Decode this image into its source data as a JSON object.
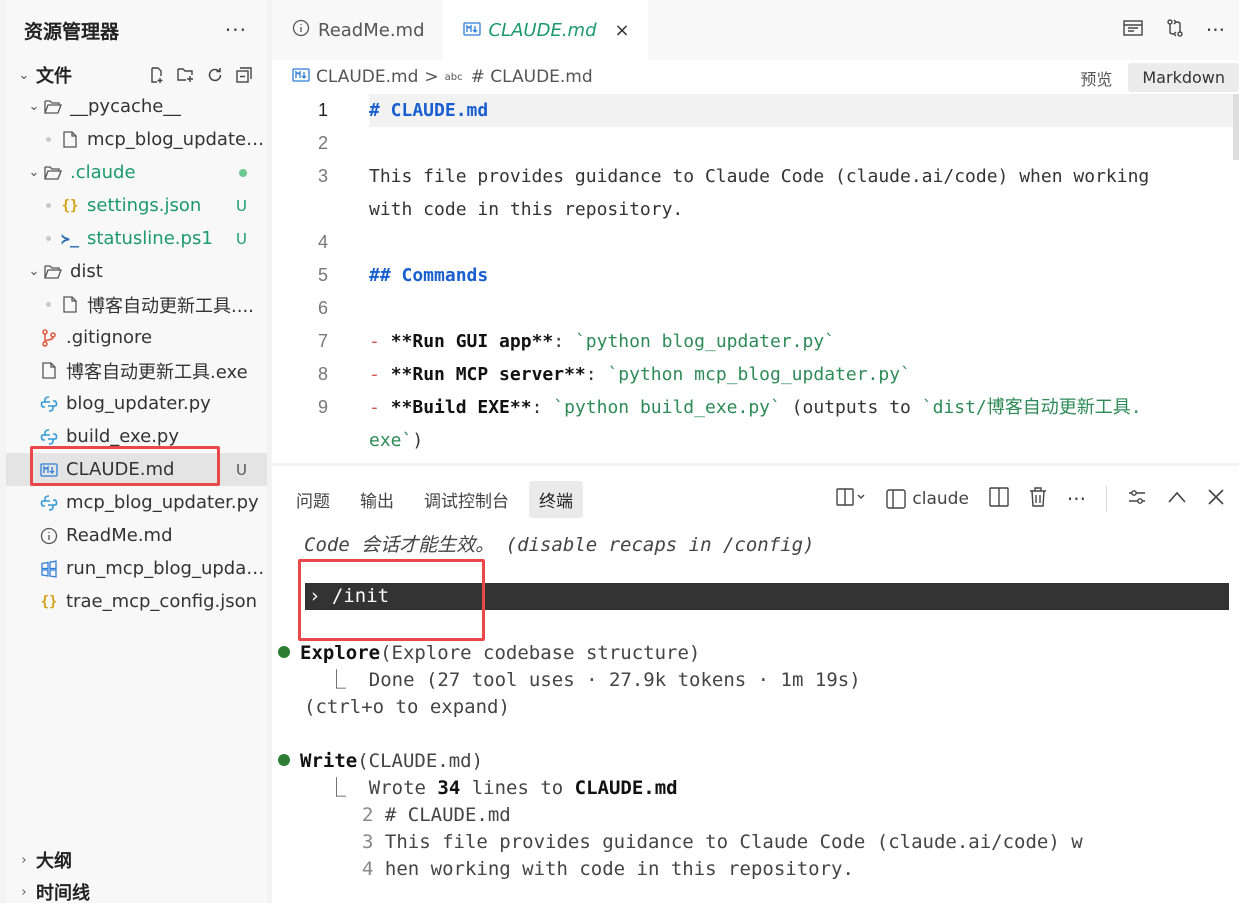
{
  "sidebar": {
    "title": "资源管理器",
    "more": "···",
    "files_section": "文件",
    "outline_section": "大纲",
    "timeline_section": "时间线",
    "tree": [
      {
        "label": "__pycache__",
        "badge": ""
      },
      {
        "label": "mcp_blog_updater...",
        "badge": ""
      },
      {
        "label": ".claude",
        "badge": ""
      },
      {
        "label": "settings.json",
        "badge": "U"
      },
      {
        "label": "statusline.ps1",
        "badge": "U"
      },
      {
        "label": "dist",
        "badge": ""
      },
      {
        "label": "博客自动更新工具....",
        "badge": ""
      },
      {
        "label": ".gitignore",
        "badge": ""
      },
      {
        "label": "博客自动更新工具.exe",
        "badge": ""
      },
      {
        "label": "blog_updater.py",
        "badge": ""
      },
      {
        "label": "build_exe.py",
        "badge": ""
      },
      {
        "label": "CLAUDE.md",
        "badge": "U"
      },
      {
        "label": "mcp_blog_updater.py",
        "badge": ""
      },
      {
        "label": "ReadMe.md",
        "badge": ""
      },
      {
        "label": "run_mcp_blog_updat...",
        "badge": ""
      },
      {
        "label": "trae_mcp_config.json",
        "badge": ""
      }
    ]
  },
  "editor": {
    "tabs": [
      {
        "label": "ReadMe.md"
      },
      {
        "label": "CLAUDE.md",
        "close": "×"
      }
    ],
    "breadcrumb": {
      "file": "CLAUDE.md",
      "sep": ">",
      "symbol": "# CLAUDE.md"
    },
    "preview_label": "预览",
    "markdown_label": "Markdown",
    "lines": [
      {
        "n": "1",
        "text": "# CLAUDE.md"
      },
      {
        "n": "2",
        "text": ""
      },
      {
        "n": "3",
        "text": "This file provides guidance to Claude Code (claude.ai/code) when working"
      },
      {
        "n": "",
        "text": "with code in this repository."
      },
      {
        "n": "4",
        "text": ""
      },
      {
        "n": "5",
        "text": "## Commands"
      },
      {
        "n": "6",
        "text": ""
      },
      {
        "n": "7",
        "p1": "- ",
        "p2": "**Run GUI app**",
        "p3": ": ",
        "p4": "`python blog_updater.py`",
        "p5": ""
      },
      {
        "n": "8",
        "p1": "- ",
        "p2": "**Run MCP server**",
        "p3": ": ",
        "p4": "`python mcp_blog_updater.py`",
        "p5": ""
      },
      {
        "n": "9",
        "p1": "- ",
        "p2": "**Build EXE**",
        "p3": ": ",
        "p4": "`python build_exe.py`",
        "p5": " (outputs to ",
        "p6": "`dist/博客自动更新工具."
      },
      {
        "n": "",
        "p6": "exe`",
        "p7": ")"
      }
    ]
  },
  "panel": {
    "tabs": [
      "问题",
      "输出",
      "调试控制台",
      "终端"
    ],
    "terminal_name": "claude",
    "terminal": {
      "l0": "Code 会话才能生效。 (disable recaps in /config)",
      "prompt": "› /init",
      "explore_bold": "Explore",
      "explore_rest": "(Explore codebase structure)",
      "done": "  ⎿  Done (27 tool uses · 27.9k tokens · 1m 19s)",
      "expand": "(ctrl+o to expand)",
      "write_bold": "Write",
      "write_rest": "(CLAUDE.md)",
      "wrote_pre": "  ⎿  Wrote ",
      "wrote_num": "34",
      "wrote_mid": " lines to ",
      "wrote_file": "CLAUDE.md",
      "c2n": "2",
      "c2": " # CLAUDE.md",
      "c3n": "3",
      "c3": " This file provides guidance to Claude Code (claude.ai/code) w",
      "c4n": "4",
      "c4": " hen working with code in this repository."
    }
  }
}
